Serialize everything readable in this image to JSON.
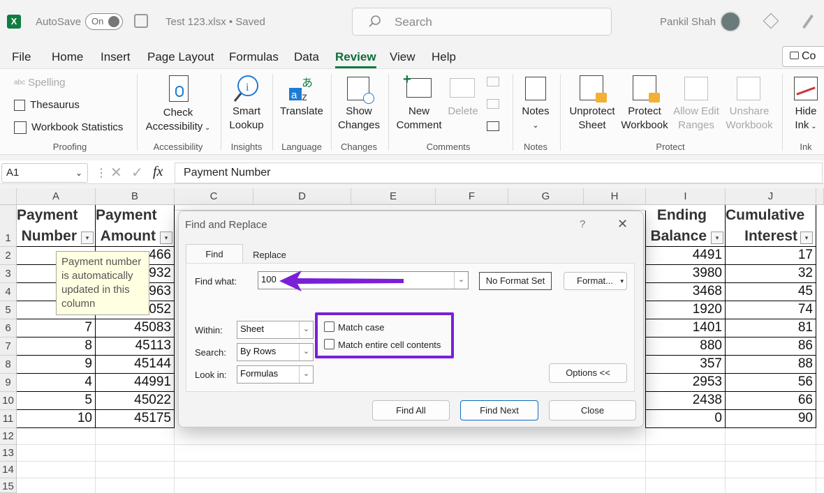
{
  "titlebar": {
    "autosave": "AutoSave",
    "toggle": "On",
    "filename": "Test 123.xlsx • Saved",
    "search_placeholder": "Search",
    "user": "Pankil Shah"
  },
  "menu": [
    "File",
    "Home",
    "Insert",
    "Page Layout",
    "Formulas",
    "Data",
    "Review",
    "View",
    "Help"
  ],
  "menu_active": "Review",
  "comments_btn": "Co",
  "ribbon": {
    "proofing": {
      "spelling": "Spelling",
      "thesaurus": "Thesaurus",
      "workbook_stats": "Workbook Statistics",
      "label": "Proofing"
    },
    "accessibility": {
      "line1": "Check",
      "line2": "Accessibility",
      "label": "Accessibility"
    },
    "insights": {
      "line1": "Smart",
      "line2": "Lookup",
      "label": "Insights"
    },
    "language": {
      "translate": "Translate",
      "label": "Language"
    },
    "changes": {
      "line1": "Show",
      "line2": "Changes",
      "label": "Changes"
    },
    "comments": {
      "new1": "New",
      "new2": "Comment",
      "delete": "Delete",
      "label": "Comments"
    },
    "notes": {
      "notes": "Notes",
      "label": "Notes"
    },
    "protect": {
      "unprotect1": "Unprotect",
      "unprotect2": "Sheet",
      "protect1": "Protect",
      "protect2": "Workbook",
      "allow1": "Allow Edit",
      "allow2": "Ranges",
      "unshare1": "Unshare",
      "unshare2": "Workbook",
      "label": "Protect"
    },
    "ink": {
      "hide1": "Hide",
      "hide2": "Ink",
      "label": "Ink"
    }
  },
  "formula_bar": {
    "name_box": "A1",
    "fx": "fx",
    "content": "Payment Number"
  },
  "columns": [
    "A",
    "B",
    "C",
    "D",
    "E",
    "F",
    "G",
    "H",
    "I",
    "J"
  ],
  "rows": [
    "1",
    "2",
    "3",
    "4",
    "5",
    "6",
    "7",
    "8",
    "9",
    "10",
    "11",
    "12",
    "13",
    "14",
    "15"
  ],
  "headers": {
    "A1": "Payment",
    "A2": "Number",
    "B1": "Payment",
    "B2": "Amount",
    "I1": "Ending",
    "I2": "Balance",
    "J1": "Cumulative",
    "J2": "Interest"
  },
  "col_a": [
    "",
    "",
    "",
    "",
    "7",
    "8",
    "9",
    "4",
    "5",
    "10"
  ],
  "col_b": [
    "466",
    "932",
    "963",
    "052",
    "45083",
    "45113",
    "45144",
    "44991",
    "45022",
    "45175"
  ],
  "col_i": [
    "4491",
    "3980",
    "3468",
    "1920",
    "1401",
    "880",
    "357",
    "2953",
    "2438",
    "0"
  ],
  "col_j": [
    "17",
    "32",
    "45",
    "74",
    "81",
    "86",
    "88",
    "56",
    "66",
    "90"
  ],
  "tooltip": "Payment number is automatically updated in this column",
  "dialog": {
    "title": "Find and Replace",
    "help": "?",
    "close_x": "✕",
    "tab_find": "Find",
    "tab_replace": "Replace",
    "find_what_label": "Find what:",
    "find_value": "100",
    "no_format": "No Format Set",
    "format_btn": "Format...",
    "within_label": "Within:",
    "within_value": "Sheet",
    "search_label": "Search:",
    "search_value": "By Rows",
    "lookin_label": "Look in:",
    "lookin_value": "Formulas",
    "match_case": "Match case",
    "match_entire": "Match entire cell contents",
    "options_btn": "Options <<",
    "find_all": "Find All",
    "find_next": "Find Next",
    "close": "Close"
  },
  "colors": {
    "accent": "#107c41",
    "annotation": "#7a1fd6"
  }
}
